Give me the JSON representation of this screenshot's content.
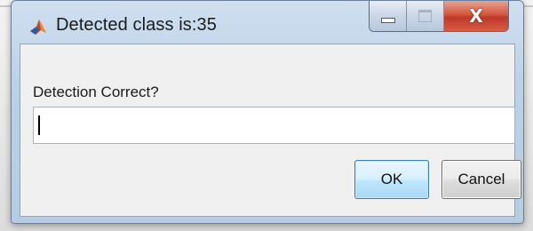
{
  "window": {
    "title": "Detected class is:35",
    "app_icon": "matlab-icon",
    "controls": {
      "minimize_icon": "minimize-icon",
      "maximize_icon": "maximize-icon",
      "close_label": "X"
    }
  },
  "dialog": {
    "prompt": "Detection Correct?",
    "input_value": "",
    "ok_label": "OK",
    "cancel_label": "Cancel"
  },
  "colors": {
    "title_bar": "#bcd0e6",
    "close_button": "#c0392b",
    "ok_button_border": "#3c7fb1",
    "client_background": "#f0f0f0"
  }
}
